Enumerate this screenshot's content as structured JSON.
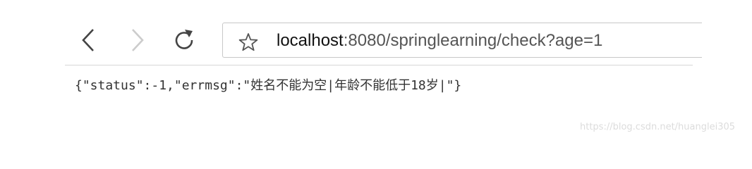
{
  "browser": {
    "nav": {
      "back_icon": "chevron-left-icon",
      "forward_icon": "chevron-right-icon",
      "reload_icon": "reload-icon",
      "forward_enabled": false
    },
    "address_bar": {
      "bookmark_icon": "star-outline-icon",
      "url_host": "localhost",
      "url_rest": ":8080/springlearning/check?age=1"
    }
  },
  "page": {
    "body_text": "{\"status\":-1,\"errmsg\":\"姓名不能为空|年龄不能低于18岁|\"}"
  },
  "watermark": {
    "text": "https://blog.csdn.net/huanglei305"
  },
  "colors": {
    "icon_active": "#444444",
    "icon_disabled": "#cccccc",
    "divider": "#d6d6d6",
    "border": "#c8c8c8"
  }
}
